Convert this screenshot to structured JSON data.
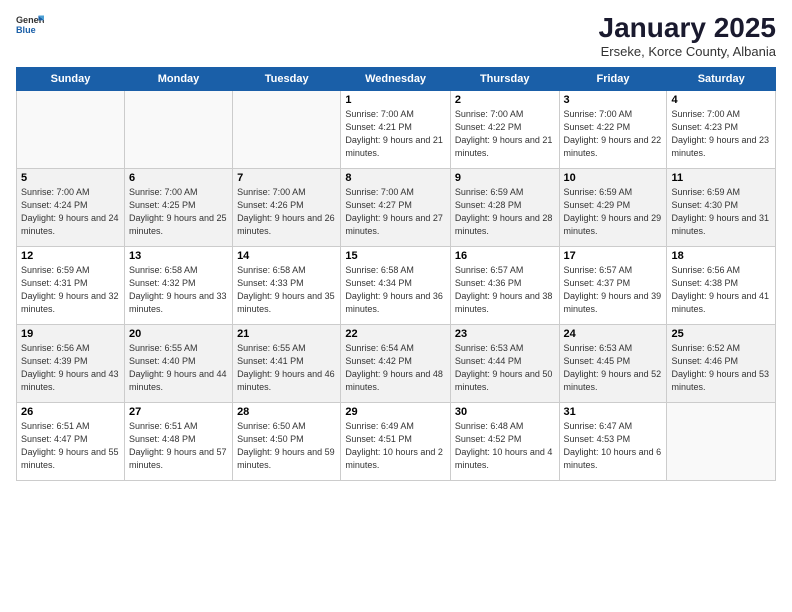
{
  "logo": {
    "general": "General",
    "blue": "Blue"
  },
  "header": {
    "month": "January 2025",
    "location": "Erseke, Korce County, Albania"
  },
  "weekdays": [
    "Sunday",
    "Monday",
    "Tuesday",
    "Wednesday",
    "Thursday",
    "Friday",
    "Saturday"
  ],
  "weeks": [
    [
      {
        "day": "",
        "info": ""
      },
      {
        "day": "",
        "info": ""
      },
      {
        "day": "",
        "info": ""
      },
      {
        "day": "1",
        "info": "Sunrise: 7:00 AM\nSunset: 4:21 PM\nDaylight: 9 hours and 21 minutes."
      },
      {
        "day": "2",
        "info": "Sunrise: 7:00 AM\nSunset: 4:22 PM\nDaylight: 9 hours and 21 minutes."
      },
      {
        "day": "3",
        "info": "Sunrise: 7:00 AM\nSunset: 4:22 PM\nDaylight: 9 hours and 22 minutes."
      },
      {
        "day": "4",
        "info": "Sunrise: 7:00 AM\nSunset: 4:23 PM\nDaylight: 9 hours and 23 minutes."
      }
    ],
    [
      {
        "day": "5",
        "info": "Sunrise: 7:00 AM\nSunset: 4:24 PM\nDaylight: 9 hours and 24 minutes."
      },
      {
        "day": "6",
        "info": "Sunrise: 7:00 AM\nSunset: 4:25 PM\nDaylight: 9 hours and 25 minutes."
      },
      {
        "day": "7",
        "info": "Sunrise: 7:00 AM\nSunset: 4:26 PM\nDaylight: 9 hours and 26 minutes."
      },
      {
        "day": "8",
        "info": "Sunrise: 7:00 AM\nSunset: 4:27 PM\nDaylight: 9 hours and 27 minutes."
      },
      {
        "day": "9",
        "info": "Sunrise: 6:59 AM\nSunset: 4:28 PM\nDaylight: 9 hours and 28 minutes."
      },
      {
        "day": "10",
        "info": "Sunrise: 6:59 AM\nSunset: 4:29 PM\nDaylight: 9 hours and 29 minutes."
      },
      {
        "day": "11",
        "info": "Sunrise: 6:59 AM\nSunset: 4:30 PM\nDaylight: 9 hours and 31 minutes."
      }
    ],
    [
      {
        "day": "12",
        "info": "Sunrise: 6:59 AM\nSunset: 4:31 PM\nDaylight: 9 hours and 32 minutes."
      },
      {
        "day": "13",
        "info": "Sunrise: 6:58 AM\nSunset: 4:32 PM\nDaylight: 9 hours and 33 minutes."
      },
      {
        "day": "14",
        "info": "Sunrise: 6:58 AM\nSunset: 4:33 PM\nDaylight: 9 hours and 35 minutes."
      },
      {
        "day": "15",
        "info": "Sunrise: 6:58 AM\nSunset: 4:34 PM\nDaylight: 9 hours and 36 minutes."
      },
      {
        "day": "16",
        "info": "Sunrise: 6:57 AM\nSunset: 4:36 PM\nDaylight: 9 hours and 38 minutes."
      },
      {
        "day": "17",
        "info": "Sunrise: 6:57 AM\nSunset: 4:37 PM\nDaylight: 9 hours and 39 minutes."
      },
      {
        "day": "18",
        "info": "Sunrise: 6:56 AM\nSunset: 4:38 PM\nDaylight: 9 hours and 41 minutes."
      }
    ],
    [
      {
        "day": "19",
        "info": "Sunrise: 6:56 AM\nSunset: 4:39 PM\nDaylight: 9 hours and 43 minutes."
      },
      {
        "day": "20",
        "info": "Sunrise: 6:55 AM\nSunset: 4:40 PM\nDaylight: 9 hours and 44 minutes."
      },
      {
        "day": "21",
        "info": "Sunrise: 6:55 AM\nSunset: 4:41 PM\nDaylight: 9 hours and 46 minutes."
      },
      {
        "day": "22",
        "info": "Sunrise: 6:54 AM\nSunset: 4:42 PM\nDaylight: 9 hours and 48 minutes."
      },
      {
        "day": "23",
        "info": "Sunrise: 6:53 AM\nSunset: 4:44 PM\nDaylight: 9 hours and 50 minutes."
      },
      {
        "day": "24",
        "info": "Sunrise: 6:53 AM\nSunset: 4:45 PM\nDaylight: 9 hours and 52 minutes."
      },
      {
        "day": "25",
        "info": "Sunrise: 6:52 AM\nSunset: 4:46 PM\nDaylight: 9 hours and 53 minutes."
      }
    ],
    [
      {
        "day": "26",
        "info": "Sunrise: 6:51 AM\nSunset: 4:47 PM\nDaylight: 9 hours and 55 minutes."
      },
      {
        "day": "27",
        "info": "Sunrise: 6:51 AM\nSunset: 4:48 PM\nDaylight: 9 hours and 57 minutes."
      },
      {
        "day": "28",
        "info": "Sunrise: 6:50 AM\nSunset: 4:50 PM\nDaylight: 9 hours and 59 minutes."
      },
      {
        "day": "29",
        "info": "Sunrise: 6:49 AM\nSunset: 4:51 PM\nDaylight: 10 hours and 2 minutes."
      },
      {
        "day": "30",
        "info": "Sunrise: 6:48 AM\nSunset: 4:52 PM\nDaylight: 10 hours and 4 minutes."
      },
      {
        "day": "31",
        "info": "Sunrise: 6:47 AM\nSunset: 4:53 PM\nDaylight: 10 hours and 6 minutes."
      },
      {
        "day": "",
        "info": ""
      }
    ]
  ]
}
